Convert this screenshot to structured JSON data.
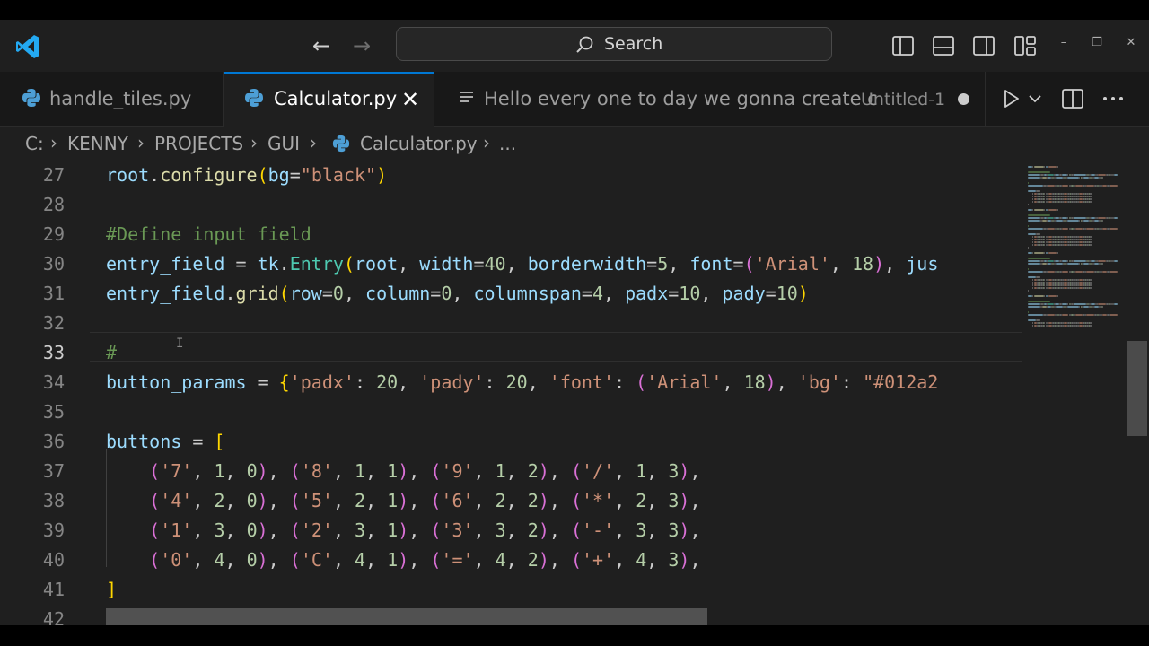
{
  "titlebar": {
    "search_label": "Search"
  },
  "tabs": [
    {
      "label": "handle_tiles.py",
      "icon": "python-icon",
      "active": false
    },
    {
      "label": "Calculator.py",
      "icon": "python-icon",
      "active": true
    },
    {
      "label": "Hello every one to day we gonna create c",
      "suffix": "Untitled-1",
      "icon": "list-icon",
      "active": false,
      "dirty": true
    }
  ],
  "breadcrumb": [
    "C:",
    "KENNY",
    "PROJECTS",
    "GUI",
    "Calculator.py",
    "..."
  ],
  "editor": {
    "active_line": "33",
    "lines": [
      {
        "num": "27",
        "tokens": [
          [
            "v",
            "root"
          ],
          [
            "",
            "."
          ],
          [
            "f",
            "configure"
          ],
          [
            "b1",
            "("
          ],
          [
            "v",
            "bg"
          ],
          [
            "",
            "="
          ],
          [
            "s",
            "\"black\""
          ],
          [
            "b1",
            ")"
          ]
        ]
      },
      {
        "num": "28",
        "tokens": []
      },
      {
        "num": "29",
        "tokens": [
          [
            "c",
            "#Define input field"
          ]
        ]
      },
      {
        "num": "30",
        "tokens": [
          [
            "v",
            "entry_field"
          ],
          [
            "",
            " = "
          ],
          [
            "v",
            "tk"
          ],
          [
            "",
            "."
          ],
          [
            "cl",
            "Entry"
          ],
          [
            "b1",
            "("
          ],
          [
            "v",
            "root"
          ],
          [
            "",
            ", "
          ],
          [
            "v",
            "width"
          ],
          [
            "",
            "="
          ],
          [
            "n",
            "40"
          ],
          [
            "",
            ", "
          ],
          [
            "v",
            "borderwidth"
          ],
          [
            "",
            "="
          ],
          [
            "n",
            "5"
          ],
          [
            "",
            ", "
          ],
          [
            "v",
            "font"
          ],
          [
            "",
            "="
          ],
          [
            "b2",
            "("
          ],
          [
            "s",
            "'Arial'"
          ],
          [
            "",
            ", "
          ],
          [
            "n",
            "18"
          ],
          [
            "b2",
            ")"
          ],
          [
            "",
            ", "
          ],
          [
            "v",
            "jus"
          ]
        ]
      },
      {
        "num": "31",
        "tokens": [
          [
            "v",
            "entry_field"
          ],
          [
            "",
            "."
          ],
          [
            "f",
            "grid"
          ],
          [
            "b1",
            "("
          ],
          [
            "v",
            "row"
          ],
          [
            "",
            "="
          ],
          [
            "n",
            "0"
          ],
          [
            "",
            ", "
          ],
          [
            "v",
            "column"
          ],
          [
            "",
            "="
          ],
          [
            "n",
            "0"
          ],
          [
            "",
            ", "
          ],
          [
            "v",
            "columnspan"
          ],
          [
            "",
            "="
          ],
          [
            "n",
            "4"
          ],
          [
            "",
            ", "
          ],
          [
            "v",
            "padx"
          ],
          [
            "",
            "="
          ],
          [
            "n",
            "10"
          ],
          [
            "",
            ", "
          ],
          [
            "v",
            "pady"
          ],
          [
            "",
            "="
          ],
          [
            "n",
            "10"
          ],
          [
            "b1",
            ")"
          ]
        ]
      },
      {
        "num": "32",
        "tokens": []
      },
      {
        "num": "33",
        "tokens": [
          [
            "c",
            "#"
          ]
        ]
      },
      {
        "num": "34",
        "tokens": [
          [
            "v",
            "button_params"
          ],
          [
            "",
            " = "
          ],
          [
            "b1",
            "{"
          ],
          [
            "s",
            "'padx'"
          ],
          [
            "",
            ": "
          ],
          [
            "n",
            "20"
          ],
          [
            "",
            ", "
          ],
          [
            "s",
            "'pady'"
          ],
          [
            "",
            ": "
          ],
          [
            "n",
            "20"
          ],
          [
            "",
            ", "
          ],
          [
            "s",
            "'font'"
          ],
          [
            "",
            ": "
          ],
          [
            "b2",
            "("
          ],
          [
            "s",
            "'Arial'"
          ],
          [
            "",
            ", "
          ],
          [
            "n",
            "18"
          ],
          [
            "b2",
            ")"
          ],
          [
            "",
            ", "
          ],
          [
            "s",
            "'bg'"
          ],
          [
            "",
            ": "
          ],
          [
            "s",
            "\"#012a2"
          ]
        ]
      },
      {
        "num": "35",
        "tokens": []
      },
      {
        "num": "36",
        "tokens": [
          [
            "v",
            "buttons"
          ],
          [
            "",
            " = "
          ],
          [
            "b1",
            "["
          ]
        ]
      },
      {
        "num": "37",
        "tokens": [
          [
            "",
            "    "
          ],
          [
            "b2",
            "("
          ],
          [
            "s",
            "'7'"
          ],
          [
            "",
            ", "
          ],
          [
            "n",
            "1"
          ],
          [
            "",
            ", "
          ],
          [
            "n",
            "0"
          ],
          [
            "b2",
            ")"
          ],
          [
            "",
            ", "
          ],
          [
            "b2",
            "("
          ],
          [
            "s",
            "'8'"
          ],
          [
            "",
            ", "
          ],
          [
            "n",
            "1"
          ],
          [
            "",
            ", "
          ],
          [
            "n",
            "1"
          ],
          [
            "b2",
            ")"
          ],
          [
            "",
            ", "
          ],
          [
            "b2",
            "("
          ],
          [
            "s",
            "'9'"
          ],
          [
            "",
            ", "
          ],
          [
            "n",
            "1"
          ],
          [
            "",
            ", "
          ],
          [
            "n",
            "2"
          ],
          [
            "b2",
            ")"
          ],
          [
            "",
            ", "
          ],
          [
            "b2",
            "("
          ],
          [
            "s",
            "'/'"
          ],
          [
            "",
            ", "
          ],
          [
            "n",
            "1"
          ],
          [
            "",
            ", "
          ],
          [
            "n",
            "3"
          ],
          [
            "b2",
            ")"
          ],
          [
            "",
            ","
          ]
        ]
      },
      {
        "num": "38",
        "tokens": [
          [
            "",
            "    "
          ],
          [
            "b2",
            "("
          ],
          [
            "s",
            "'4'"
          ],
          [
            "",
            ", "
          ],
          [
            "n",
            "2"
          ],
          [
            "",
            ", "
          ],
          [
            "n",
            "0"
          ],
          [
            "b2",
            ")"
          ],
          [
            "",
            ", "
          ],
          [
            "b2",
            "("
          ],
          [
            "s",
            "'5'"
          ],
          [
            "",
            ", "
          ],
          [
            "n",
            "2"
          ],
          [
            "",
            ", "
          ],
          [
            "n",
            "1"
          ],
          [
            "b2",
            ")"
          ],
          [
            "",
            ", "
          ],
          [
            "b2",
            "("
          ],
          [
            "s",
            "'6'"
          ],
          [
            "",
            ", "
          ],
          [
            "n",
            "2"
          ],
          [
            "",
            ", "
          ],
          [
            "n",
            "2"
          ],
          [
            "b2",
            ")"
          ],
          [
            "",
            ", "
          ],
          [
            "b2",
            "("
          ],
          [
            "s",
            "'*'"
          ],
          [
            "",
            ", "
          ],
          [
            "n",
            "2"
          ],
          [
            "",
            ", "
          ],
          [
            "n",
            "3"
          ],
          [
            "b2",
            ")"
          ],
          [
            "",
            ","
          ]
        ]
      },
      {
        "num": "39",
        "tokens": [
          [
            "",
            "    "
          ],
          [
            "b2",
            "("
          ],
          [
            "s",
            "'1'"
          ],
          [
            "",
            ", "
          ],
          [
            "n",
            "3"
          ],
          [
            "",
            ", "
          ],
          [
            "n",
            "0"
          ],
          [
            "b2",
            ")"
          ],
          [
            "",
            ", "
          ],
          [
            "b2",
            "("
          ],
          [
            "s",
            "'2'"
          ],
          [
            "",
            ", "
          ],
          [
            "n",
            "3"
          ],
          [
            "",
            ", "
          ],
          [
            "n",
            "1"
          ],
          [
            "b2",
            ")"
          ],
          [
            "",
            ", "
          ],
          [
            "b2",
            "("
          ],
          [
            "s",
            "'3'"
          ],
          [
            "",
            ", "
          ],
          [
            "n",
            "3"
          ],
          [
            "",
            ", "
          ],
          [
            "n",
            "2"
          ],
          [
            "b2",
            ")"
          ],
          [
            "",
            ", "
          ],
          [
            "b2",
            "("
          ],
          [
            "s",
            "'-'"
          ],
          [
            "",
            ", "
          ],
          [
            "n",
            "3"
          ],
          [
            "",
            ", "
          ],
          [
            "n",
            "3"
          ],
          [
            "b2",
            ")"
          ],
          [
            "",
            ","
          ]
        ]
      },
      {
        "num": "40",
        "tokens": [
          [
            "",
            "    "
          ],
          [
            "b2",
            "("
          ],
          [
            "s",
            "'0'"
          ],
          [
            "",
            ", "
          ],
          [
            "n",
            "4"
          ],
          [
            "",
            ", "
          ],
          [
            "n",
            "0"
          ],
          [
            "b2",
            ")"
          ],
          [
            "",
            ", "
          ],
          [
            "b2",
            "("
          ],
          [
            "s",
            "'C'"
          ],
          [
            "",
            ", "
          ],
          [
            "n",
            "4"
          ],
          [
            "",
            ", "
          ],
          [
            "n",
            "1"
          ],
          [
            "b2",
            ")"
          ],
          [
            "",
            ", "
          ],
          [
            "b2",
            "("
          ],
          [
            "s",
            "'='"
          ],
          [
            "",
            ", "
          ],
          [
            "n",
            "4"
          ],
          [
            "",
            ", "
          ],
          [
            "n",
            "2"
          ],
          [
            "b2",
            ")"
          ],
          [
            "",
            ", "
          ],
          [
            "b2",
            "("
          ],
          [
            "s",
            "'+'"
          ],
          [
            "",
            ", "
          ],
          [
            "n",
            "4"
          ],
          [
            "",
            ", "
          ],
          [
            "n",
            "3"
          ],
          [
            "b2",
            ")"
          ],
          [
            "",
            ","
          ]
        ]
      },
      {
        "num": "41",
        "tokens": [
          [
            "b1",
            "]"
          ]
        ]
      },
      {
        "num": "42",
        "tokens": []
      }
    ]
  },
  "colors": {
    "accent": "#0078d4",
    "editor_bg": "#1f1f1f",
    "string": "#ce9178",
    "comment": "#6a9955",
    "number": "#b5cea8",
    "variable": "#9cdcfe",
    "function": "#dcdcaa",
    "class": "#4ec9b0"
  }
}
